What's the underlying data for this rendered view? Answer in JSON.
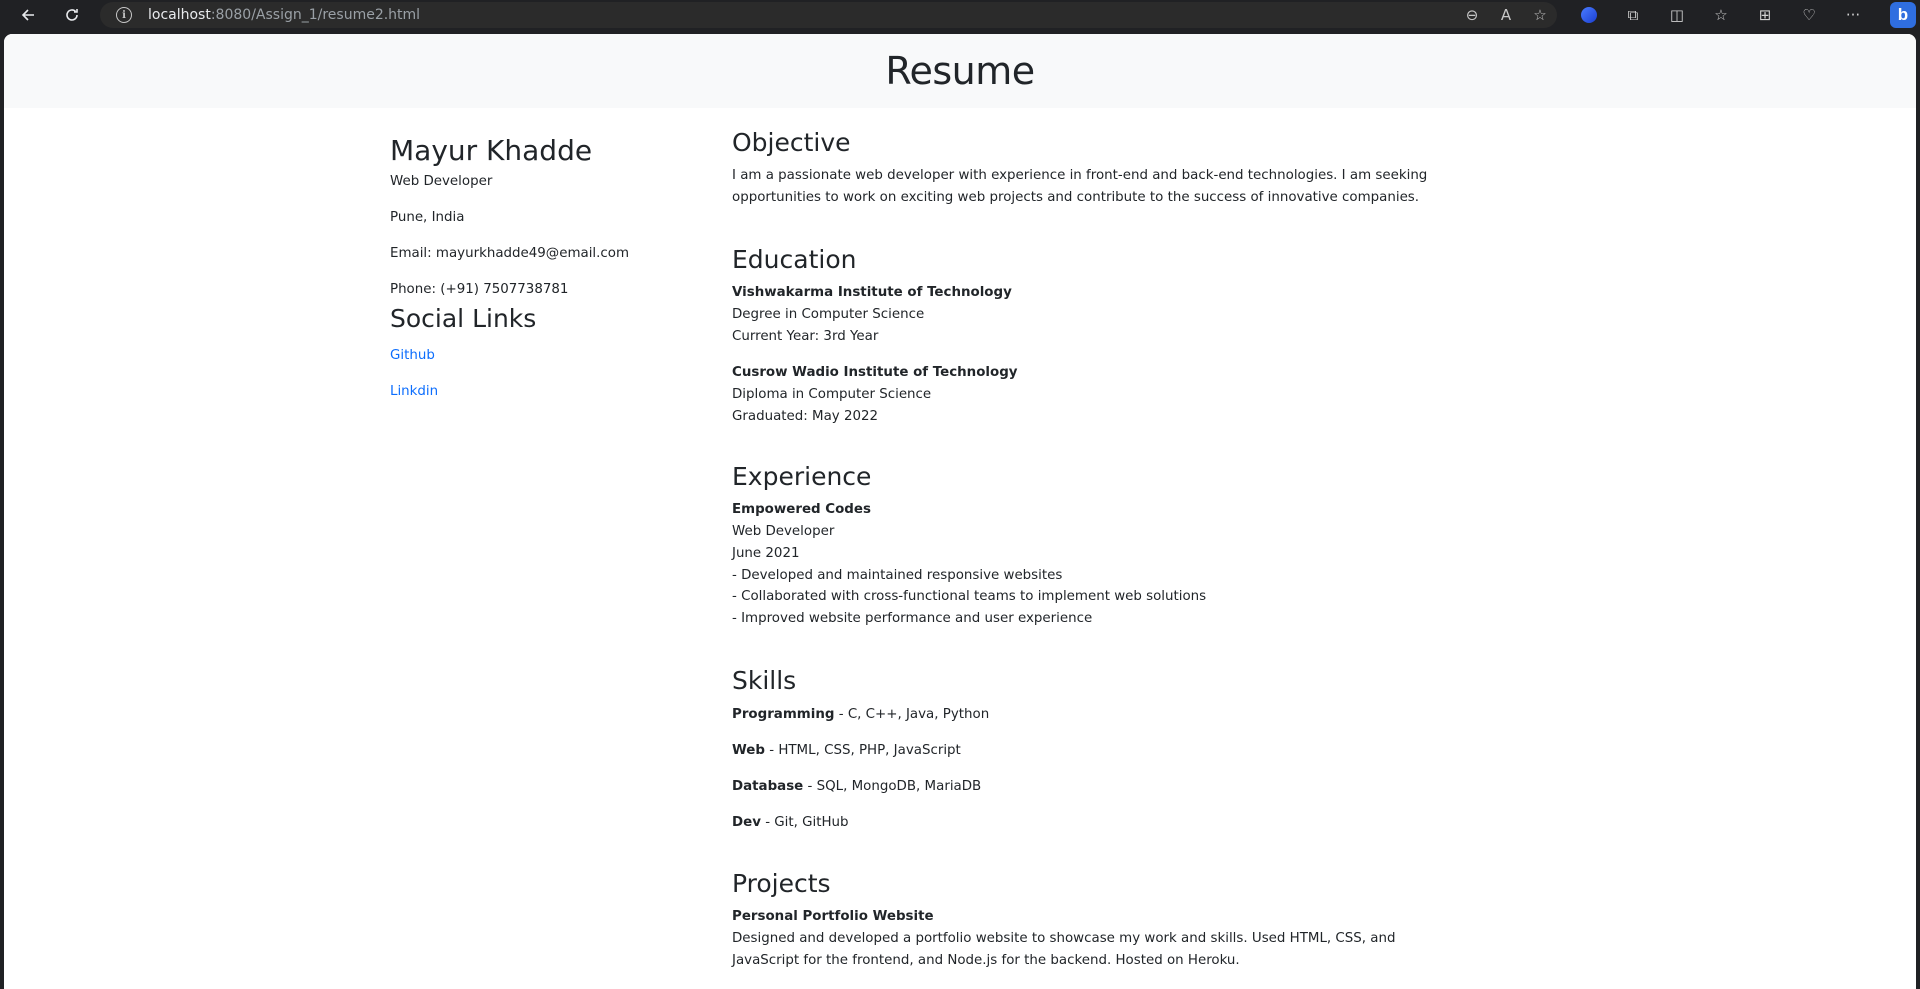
{
  "browser": {
    "url_host": "localhost",
    "url_rest": ":8080/Assign_1/resume2.html",
    "icons": [
      "back-icon",
      "reload-icon",
      "info-icon",
      "zoom-out-icon",
      "read-aloud-icon",
      "favorite-star-icon",
      "copilot-icon",
      "extensions-icon",
      "split-screen-icon",
      "favorites-icon",
      "collections-icon",
      "performance-icon",
      "more-icon",
      "bing-icon"
    ]
  },
  "header": {
    "title": "Resume"
  },
  "profile": {
    "name": "Mayur Khadde",
    "role": "Web Developer",
    "location": "Pune, India",
    "email": "Email: mayurkhadde49@email.com",
    "phone": "Phone: (+91) 7507738781"
  },
  "social": {
    "heading": "Social Links",
    "links": [
      "Github",
      "Linkdin"
    ]
  },
  "objective": {
    "heading": "Objective",
    "lines": [
      "I am a passionate web developer with experience in front-end and back-end technologies. I am seeking",
      "opportunities to work on exciting web projects and contribute to the success of innovative companies."
    ]
  },
  "education": {
    "heading": "Education",
    "items": [
      {
        "school": "Vishwakarma Institute of Technology",
        "degree": "Degree in Computer Science",
        "detail": "Current Year: 3rd Year"
      },
      {
        "school": "Cusrow Wadio Institute of Technology",
        "degree": "Diploma in Computer Science",
        "detail": "Graduated: May 2022"
      }
    ]
  },
  "experience": {
    "heading": "Experience",
    "company": "Empowered Codes",
    "role": "Web Developer",
    "date": "June 2021",
    "points": [
      "- Developed and maintained responsive websites",
      "- Collaborated with cross-functional teams to implement web solutions",
      "- Improved website performance and user experience"
    ]
  },
  "skills": {
    "heading": "Skills",
    "items": [
      {
        "label": "Programming",
        "value": " - C, C++, Java, Python"
      },
      {
        "label": "Web",
        "value": " - HTML, CSS, PHP, JavaScript"
      },
      {
        "label": "Database",
        "value": " - SQL, MongoDB, MariaDB"
      },
      {
        "label": "Dev",
        "value": " - Git, GitHub"
      }
    ]
  },
  "projects": {
    "heading": "Projects",
    "title": "Personal Portfolio Website",
    "lines": [
      "Designed and developed a portfolio website to showcase my work and skills. Used HTML, CSS, and",
      "JavaScript for the frontend, and Node.js for the backend. Hosted on Heroku."
    ]
  },
  "colors": {
    "link": "#0d6efd",
    "header_bg": "#f8f9fa",
    "text": "#212529",
    "chrome": "#202124"
  }
}
